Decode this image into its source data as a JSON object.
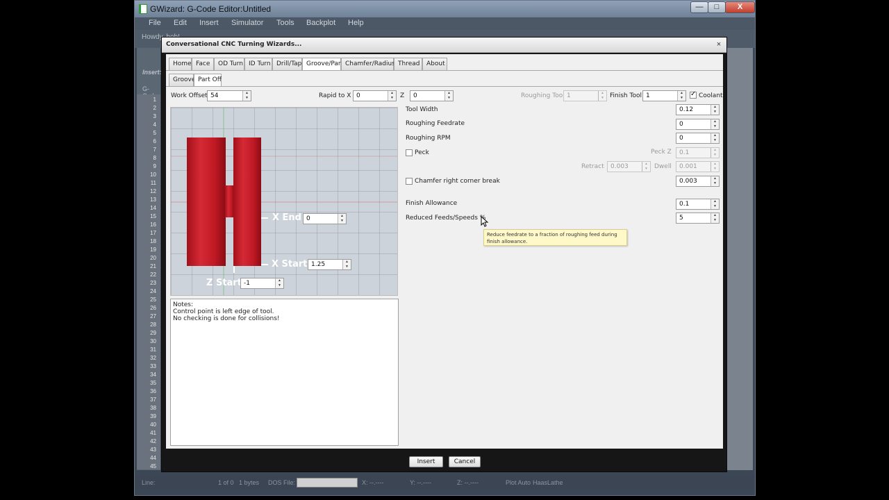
{
  "window": {
    "title": "GWizard: G-Code Editor:Untitled",
    "min_label": "—",
    "max_label": "□",
    "close_label": "X"
  },
  "menu": [
    "File",
    "Edit",
    "Insert",
    "Simulator",
    "Tools",
    "Backplot",
    "Help"
  ],
  "toolbar": {
    "howdy": "Howdy, bob!"
  },
  "left_labels": {
    "insert": "Insert:",
    "gcode": "G-Code"
  },
  "line_numbers": [
    "1",
    "2",
    "3",
    "4",
    "5",
    "6",
    "7",
    "8",
    "9",
    "10",
    "11",
    "12",
    "13",
    "14",
    "15",
    "16",
    "17",
    "18",
    "19",
    "20",
    "21",
    "22",
    "23",
    "24",
    "25",
    "26",
    "27",
    "28",
    "29",
    "30",
    "31",
    "32",
    "33",
    "34",
    "35",
    "36",
    "37",
    "38",
    "39",
    "40",
    "41",
    "42",
    "43",
    "44",
    "45"
  ],
  "status": {
    "line": "Line:",
    "position": "1 of 0",
    "bytes": "1 bytes",
    "dos_file": "DOS File:",
    "x": "X: --.----",
    "y": "Y: --.----",
    "z": "Z: --.----",
    "plot": "Plot Auto",
    "machine": "HaasLathe"
  },
  "dialog": {
    "title": "Conversational CNC Turning Wizards...",
    "close_label": "×",
    "tabs": [
      "Home",
      "Face",
      "OD Turn",
      "ID Turn",
      "Drill/Tap",
      "Groove/Part",
      "Chamfer/Radius",
      "Thread",
      "About"
    ],
    "active_tab": "Groove/Part",
    "subtabs": [
      "Groove",
      "Part Off"
    ],
    "active_subtab": "Part Off",
    "fields": {
      "work_offset": {
        "label": "Work Offset",
        "value": "54"
      },
      "rapid_x": {
        "label": "Rapid to X",
        "value": "0"
      },
      "rapid_z": {
        "label": "Z",
        "value": "0"
      },
      "roughing_tool": {
        "label": "Roughing Tool",
        "value": "1"
      },
      "finish_tool": {
        "label": "Finish Tool",
        "value": "1"
      },
      "coolant": {
        "label": "Coolant",
        "checked": true
      },
      "tool_width": {
        "label": "Tool Width",
        "value": "0.12"
      },
      "roughing_feedrate": {
        "label": "Roughing Feedrate",
        "value": "0"
      },
      "roughing_rpm": {
        "label": "Roughing RPM",
        "value": "0"
      },
      "peck": {
        "label": "Peck",
        "checked": false
      },
      "peck_z": {
        "label": "Peck Z",
        "value": "0.1"
      },
      "retract": {
        "label": "Retract",
        "value": "0.003"
      },
      "dwell": {
        "label": "Dwell",
        "value": "0.001"
      },
      "chamfer": {
        "label": "Chamfer right corner break",
        "checked": false,
        "value": "0.003"
      },
      "finish_allowance": {
        "label": "Finish Allowance",
        "value": "0.1"
      },
      "reduced_feeds": {
        "label": "Reduced Feeds/Speeds %",
        "value": "5"
      }
    },
    "diagram": {
      "x_end": {
        "label": "X End",
        "value": "0"
      },
      "x_start": {
        "label": "X Start",
        "value": "1.25"
      },
      "z_start": {
        "label": "Z Start",
        "value": "-1"
      }
    },
    "notes": [
      "Notes:",
      "Control point is left edge of tool.",
      "No checking is done for collisions!"
    ],
    "tooltip": "Reduce feedrate to a fraction of roughing feed during finish allowance.",
    "buttons": {
      "insert": "Insert",
      "cancel": "Cancel"
    }
  }
}
